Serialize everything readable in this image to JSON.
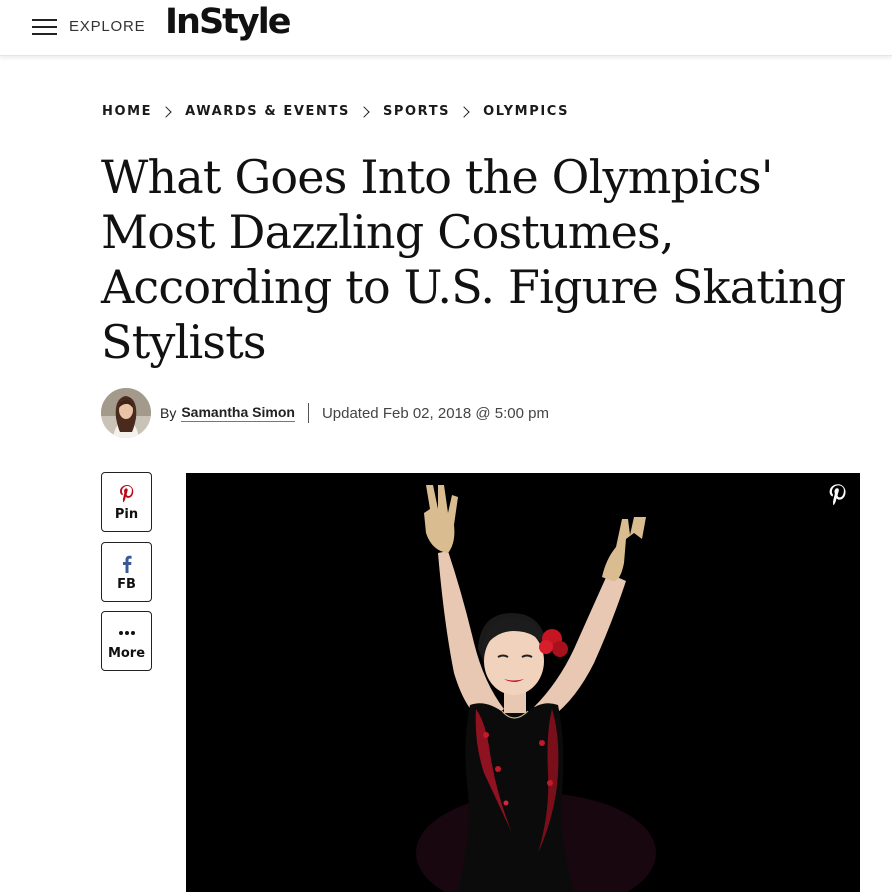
{
  "header": {
    "menu_label": "EXPLORE",
    "logo_text": "InStyle"
  },
  "breadcrumb": [
    "HOME",
    "AWARDS & EVENTS",
    "SPORTS",
    "OLYMPICS"
  ],
  "article": {
    "headline": "What Goes Into the Olympics' Most Dazzling Costumes, According to U.S. Figure Skating Stylists",
    "by_prefix": "By",
    "author": "Samantha Simon",
    "updated": "Updated Feb 02, 2018 @ 5:00 pm"
  },
  "share": {
    "pin_label": "Pin",
    "fb_label": "FB",
    "more_label": "More"
  },
  "icons": {
    "menu": "hamburger-icon",
    "pinterest": "pinterest-icon",
    "facebook": "facebook-icon",
    "more": "more-dots-icon",
    "image_pin": "pinterest-save-icon"
  },
  "colors": {
    "pinterest_red": "#bd081c",
    "facebook_blue": "#3b5998",
    "hero_background": "#000000"
  }
}
